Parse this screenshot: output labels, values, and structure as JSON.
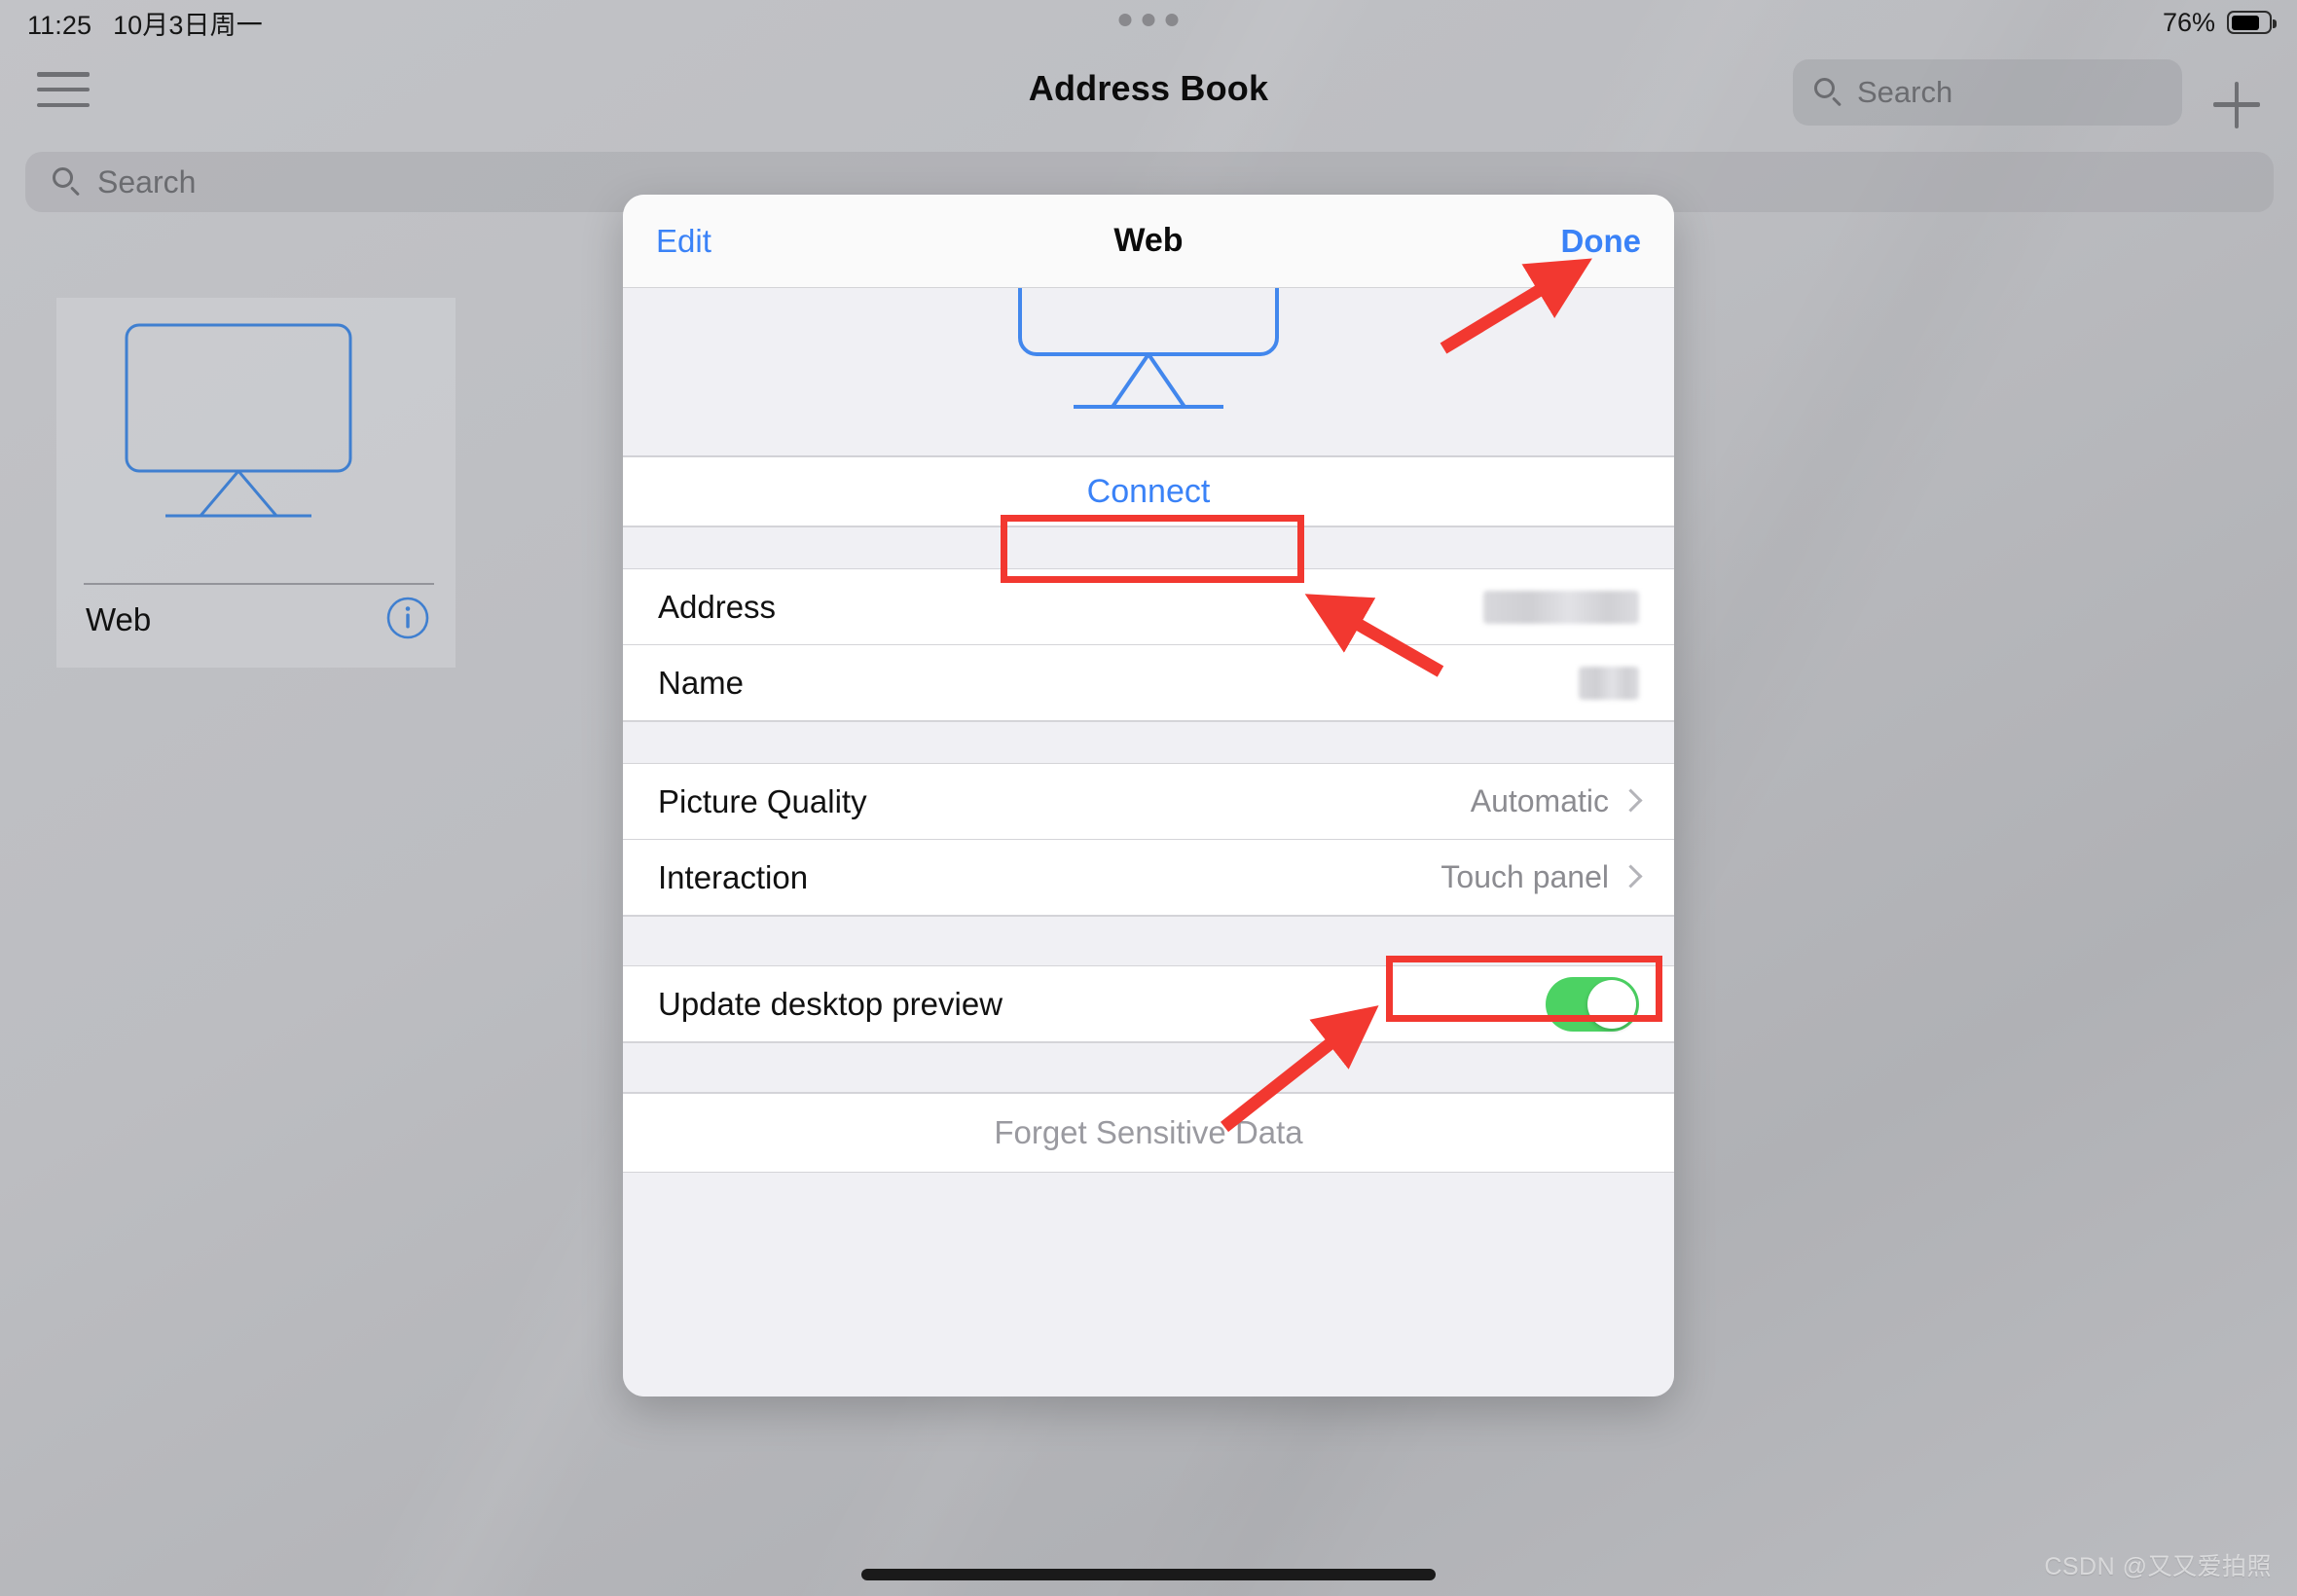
{
  "status_bar": {
    "time": "11:25",
    "date": "10月3日周一",
    "battery_percent": "76%",
    "battery_level": 76
  },
  "nav": {
    "title": "Address Book",
    "menu_icon": "hamburger-icon",
    "add_icon": "plus-icon",
    "search_placeholder": "Search"
  },
  "content_search": {
    "placeholder": "Search",
    "search_icon": "search-icon"
  },
  "device_card": {
    "label": "Web",
    "icon": "monitor-icon",
    "info_icon": "info-circle-icon"
  },
  "modal": {
    "edit_label": "Edit",
    "title": "Web",
    "done_label": "Done",
    "preview_icon": "monitor-icon",
    "connect_label": "Connect",
    "rows": [
      {
        "label": "Address",
        "value": "",
        "redacted": true,
        "redact_width": 160
      },
      {
        "label": "Name",
        "value": "",
        "redacted": true,
        "redact_width": 62
      }
    ],
    "settings": [
      {
        "label": "Picture Quality",
        "value": "Automatic",
        "chevron": true
      },
      {
        "label": "Interaction",
        "value": "Touch panel",
        "chevron": true
      }
    ],
    "toggle_row": {
      "label": "Update desktop preview",
      "state": "on"
    },
    "forget_label": "Forget Sensitive Data"
  },
  "annotations": {
    "arrow_color": "#f23830",
    "boxes": [
      {
        "name": "connect-highlight"
      },
      {
        "name": "interaction-value-highlight"
      }
    ]
  },
  "watermark": "CSDN @又又爱拍照",
  "colors": {
    "accent_blue": "#3a82f7",
    "toggle_green": "#4cd263",
    "annotation_red": "#f23830"
  }
}
